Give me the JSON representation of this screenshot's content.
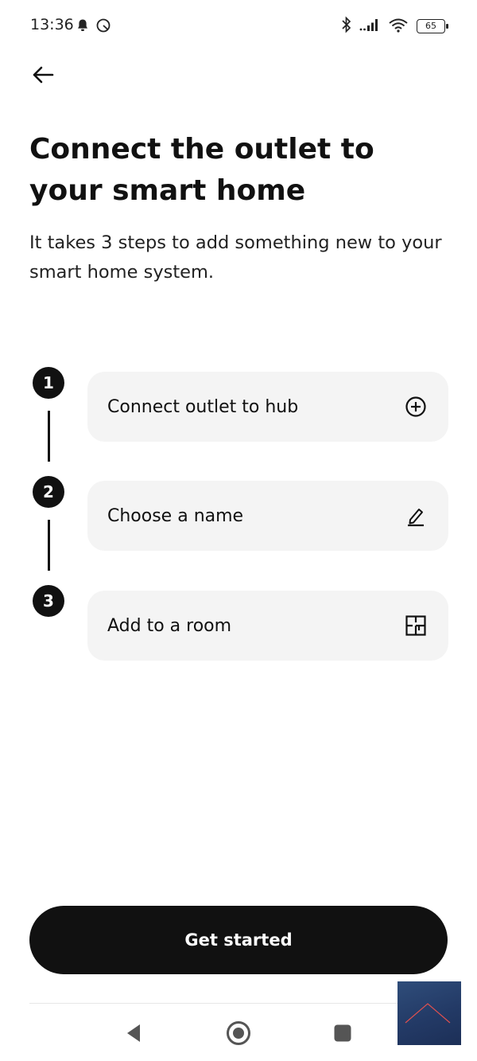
{
  "status_bar": {
    "time": "13:36",
    "battery": "65",
    "icons_left": [
      "bell-icon",
      "sync-icon"
    ],
    "icons_right": [
      "bluetooth-icon",
      "signal-icon",
      "wifi-icon",
      "battery-icon"
    ]
  },
  "header": {
    "title": "Connect the outlet to your smart home",
    "subtitle": "It takes 3 steps to add something new to your smart home system."
  },
  "steps": [
    {
      "number": "1",
      "label": "Connect outlet to hub",
      "icon": "add-circle-icon"
    },
    {
      "number": "2",
      "label": "Choose a name",
      "icon": "edit-icon"
    },
    {
      "number": "3",
      "label": "Add to a room",
      "icon": "floorplan-icon"
    }
  ],
  "actions": {
    "primary_label": "Get started"
  },
  "nav_bar": {
    "buttons": [
      "back-icon",
      "home-icon",
      "recents-icon"
    ]
  },
  "colors": {
    "primary": "#111111",
    "card_background": "#f4f4f4",
    "text": "#111111"
  }
}
